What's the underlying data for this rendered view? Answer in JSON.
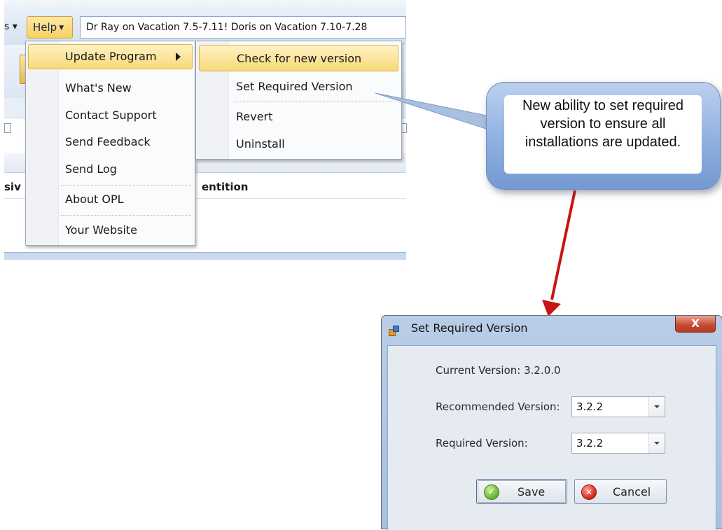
{
  "app": {
    "menu_left_fragment": "s ▾",
    "help_label": "Help",
    "ticker_text": "Dr Ray on Vacation 7.5-7.11!  Doris on Vacation 7.10-7.28",
    "column_left_fragment": "siv",
    "column_right_fragment": "entition"
  },
  "help_menu": {
    "items": [
      {
        "label": "Update Program",
        "highlighted": true,
        "has_submenu": true
      },
      {
        "label": "What's New"
      },
      {
        "label": "Contact Support"
      },
      {
        "label": "Send Feedback"
      },
      {
        "label": "Send Log"
      },
      {
        "label": "About OPL"
      },
      {
        "label": "Your Website"
      }
    ]
  },
  "update_submenu": {
    "items": [
      {
        "label": "Check for new version",
        "highlighted": true
      },
      {
        "label": "Set Required Version"
      },
      {
        "label": "Revert"
      },
      {
        "label": "Uninstall"
      }
    ]
  },
  "callout": {
    "text": "New ability to set required version to ensure all installations are updated."
  },
  "dialog": {
    "title": "Set Required Version",
    "close_label": "X",
    "current_version_label": "Current Version: 3.2.0.0",
    "recommended_label": "Recommended Version:",
    "recommended_value": "3.2.2",
    "required_label": "Required Version:",
    "required_value": "3.2.2",
    "save_label": "Save",
    "cancel_label": "Cancel"
  },
  "colors": {
    "highlight": "#f8d978",
    "callout_blue": "#8fb0e0",
    "arrow_red": "#c81414"
  },
  "icons": {
    "submenu_arrow": "chevron-right-icon",
    "ok": "check-circle-icon",
    "cancel": "x-circle-icon",
    "dropdown": "chevron-down-icon"
  }
}
